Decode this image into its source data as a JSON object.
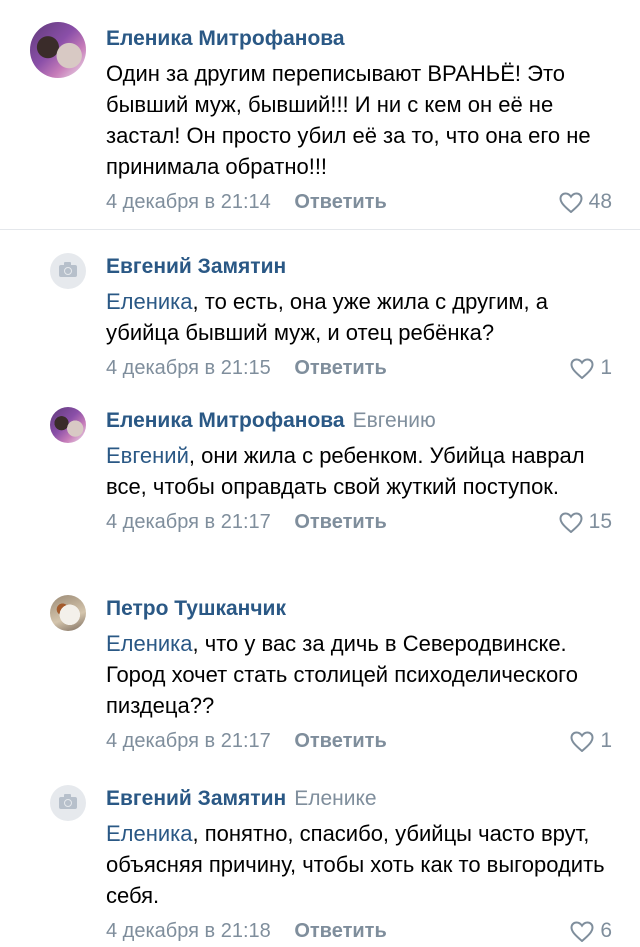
{
  "comments": [
    {
      "author": "Еленика Митрофанова",
      "reply_to": "",
      "mention": "",
      "text": "Один за другим переписывают ВРАНЬЁ! Это бывший муж, бывший!!! И ни с кем он её не застал! Он просто убил её за то, что она его не принимала обратно!!!",
      "date": "4 декабря в 21:14",
      "reply_label": "Ответить",
      "likes": "48",
      "avatar_icon": "profile-photo"
    },
    {
      "author": "Евгений Замятин",
      "reply_to": "",
      "mention": "Еленика",
      "text": ", то есть, она уже жила с другим, а убийца бывший муж, и отец ребёнка?",
      "date": "4 декабря в 21:15",
      "reply_label": "Ответить",
      "likes": "1",
      "avatar_icon": "camera-icon"
    },
    {
      "author": "Еленика Митрофанова",
      "reply_to": "Евгению",
      "mention": "Евгений",
      "text": ", они жила с ребенком. Убийца наврал все, чтобы оправдать свой жуткий поступок.",
      "date": "4 декабря в 21:17",
      "reply_label": "Ответить",
      "likes": "15",
      "avatar_icon": "profile-photo"
    },
    {
      "author": "Петро Тушканчик",
      "reply_to": "",
      "mention": "Еленика",
      "text": ", что у вас за дичь в Северодвинске. Город хочет стать столицей психоделического пиздеца??",
      "date": "4 декабря в 21:17",
      "reply_label": "Ответить",
      "likes": "1",
      "avatar_icon": "profile-photo"
    },
    {
      "author": "Евгений Замятин",
      "reply_to": "Еленике",
      "mention": "Еленика",
      "text": ", понятно, спасибо, убийцы часто врут, объясняя причину, чтобы хоть как то выгородить себя.",
      "date": "4 декабря в 21:18",
      "reply_label": "Ответить",
      "likes": "6",
      "avatar_icon": "camera-icon"
    }
  ],
  "colors": {
    "link": "#2a5885",
    "muted": "#7f8e9c",
    "separator": "#e4e7eb"
  }
}
